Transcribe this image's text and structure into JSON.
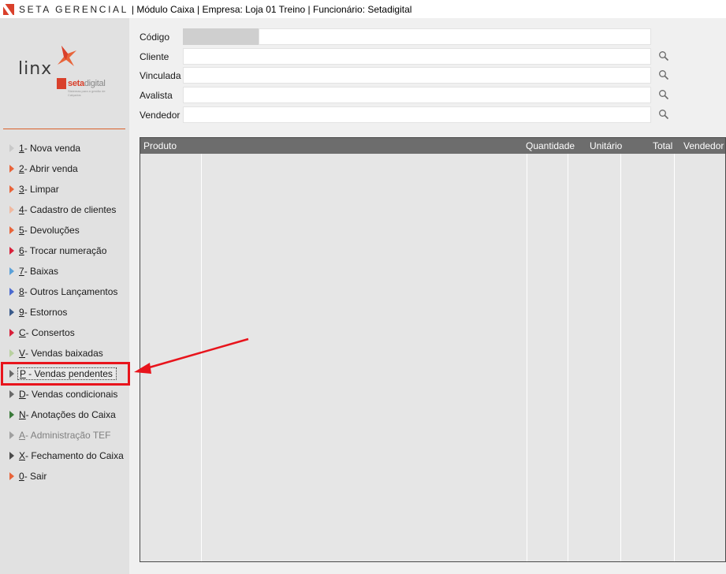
{
  "title": {
    "brand": "SETA GERENCIAL",
    "details": "| Módulo Caixa | Empresa: Loja 01 Treino | Funcionário: Setadigital"
  },
  "logo": {
    "linx": "linx",
    "seta_main": "seta",
    "seta_digital": "digital",
    "seta_tagline": "Sistemas para a gestão de Calçados"
  },
  "form": {
    "codigo_label": "Código",
    "cliente_label": "Cliente",
    "vinculada_label": "Vinculada",
    "avalista_label": "Avalista",
    "vendedor_label": "Vendedor",
    "codigo_value": "",
    "cliente_value": "",
    "vinculada_value": "",
    "avalista_value": "",
    "vendedor_value": ""
  },
  "menu": [
    {
      "key": "1",
      "label": " - Nova venda",
      "color": "#c9c9c9"
    },
    {
      "key": "2",
      "label": " - Abrir venda",
      "color": "#e8643a"
    },
    {
      "key": "3",
      "label": " - Limpar",
      "color": "#e8643a"
    },
    {
      "key": "4",
      "label": " - Cadastro de clientes",
      "color": "#f0b9a0"
    },
    {
      "key": "5",
      "label": " - Devoluções",
      "color": "#e8643a"
    },
    {
      "key": "6",
      "label": " - Trocar numeração",
      "color": "#d8203a"
    },
    {
      "key": "7",
      "label": " - Baixas",
      "color": "#5aa0d8"
    },
    {
      "key": "8",
      "label": " - Outros Lançamentos",
      "color": "#4a6ad0"
    },
    {
      "key": "9",
      "label": " - Estornos",
      "color": "#3a5a8a"
    },
    {
      "key": "C",
      "label": " - Consertos",
      "color": "#d8203a"
    },
    {
      "key": "V",
      "label": " - Vendas baixadas",
      "color": "#b8d0a0"
    },
    {
      "key": "P",
      "label": " - Vendas pendentes",
      "color": "#6a6a6a"
    },
    {
      "key": "D",
      "label": " - Vendas condicionais",
      "color": "#6a6a6a"
    },
    {
      "key": "N",
      "label": " - Anotações do Caixa",
      "color": "#3a7a3a"
    },
    {
      "key": "A",
      "label": " - Administração TEF",
      "color": "#a0a0a0"
    },
    {
      "key": "X",
      "label": " - Fechamento do Caixa",
      "color": "#4a4a4a"
    },
    {
      "key": "0",
      "label": " - Sair",
      "color": "#e8643a"
    }
  ],
  "grid": {
    "columns": [
      "Produto",
      "Quantidade",
      "Unitário",
      "Total",
      "Vendedor"
    ]
  },
  "colors": {
    "highlight": "#e8141c",
    "arrow": "#e8141c",
    "brand": "#d9402b"
  }
}
